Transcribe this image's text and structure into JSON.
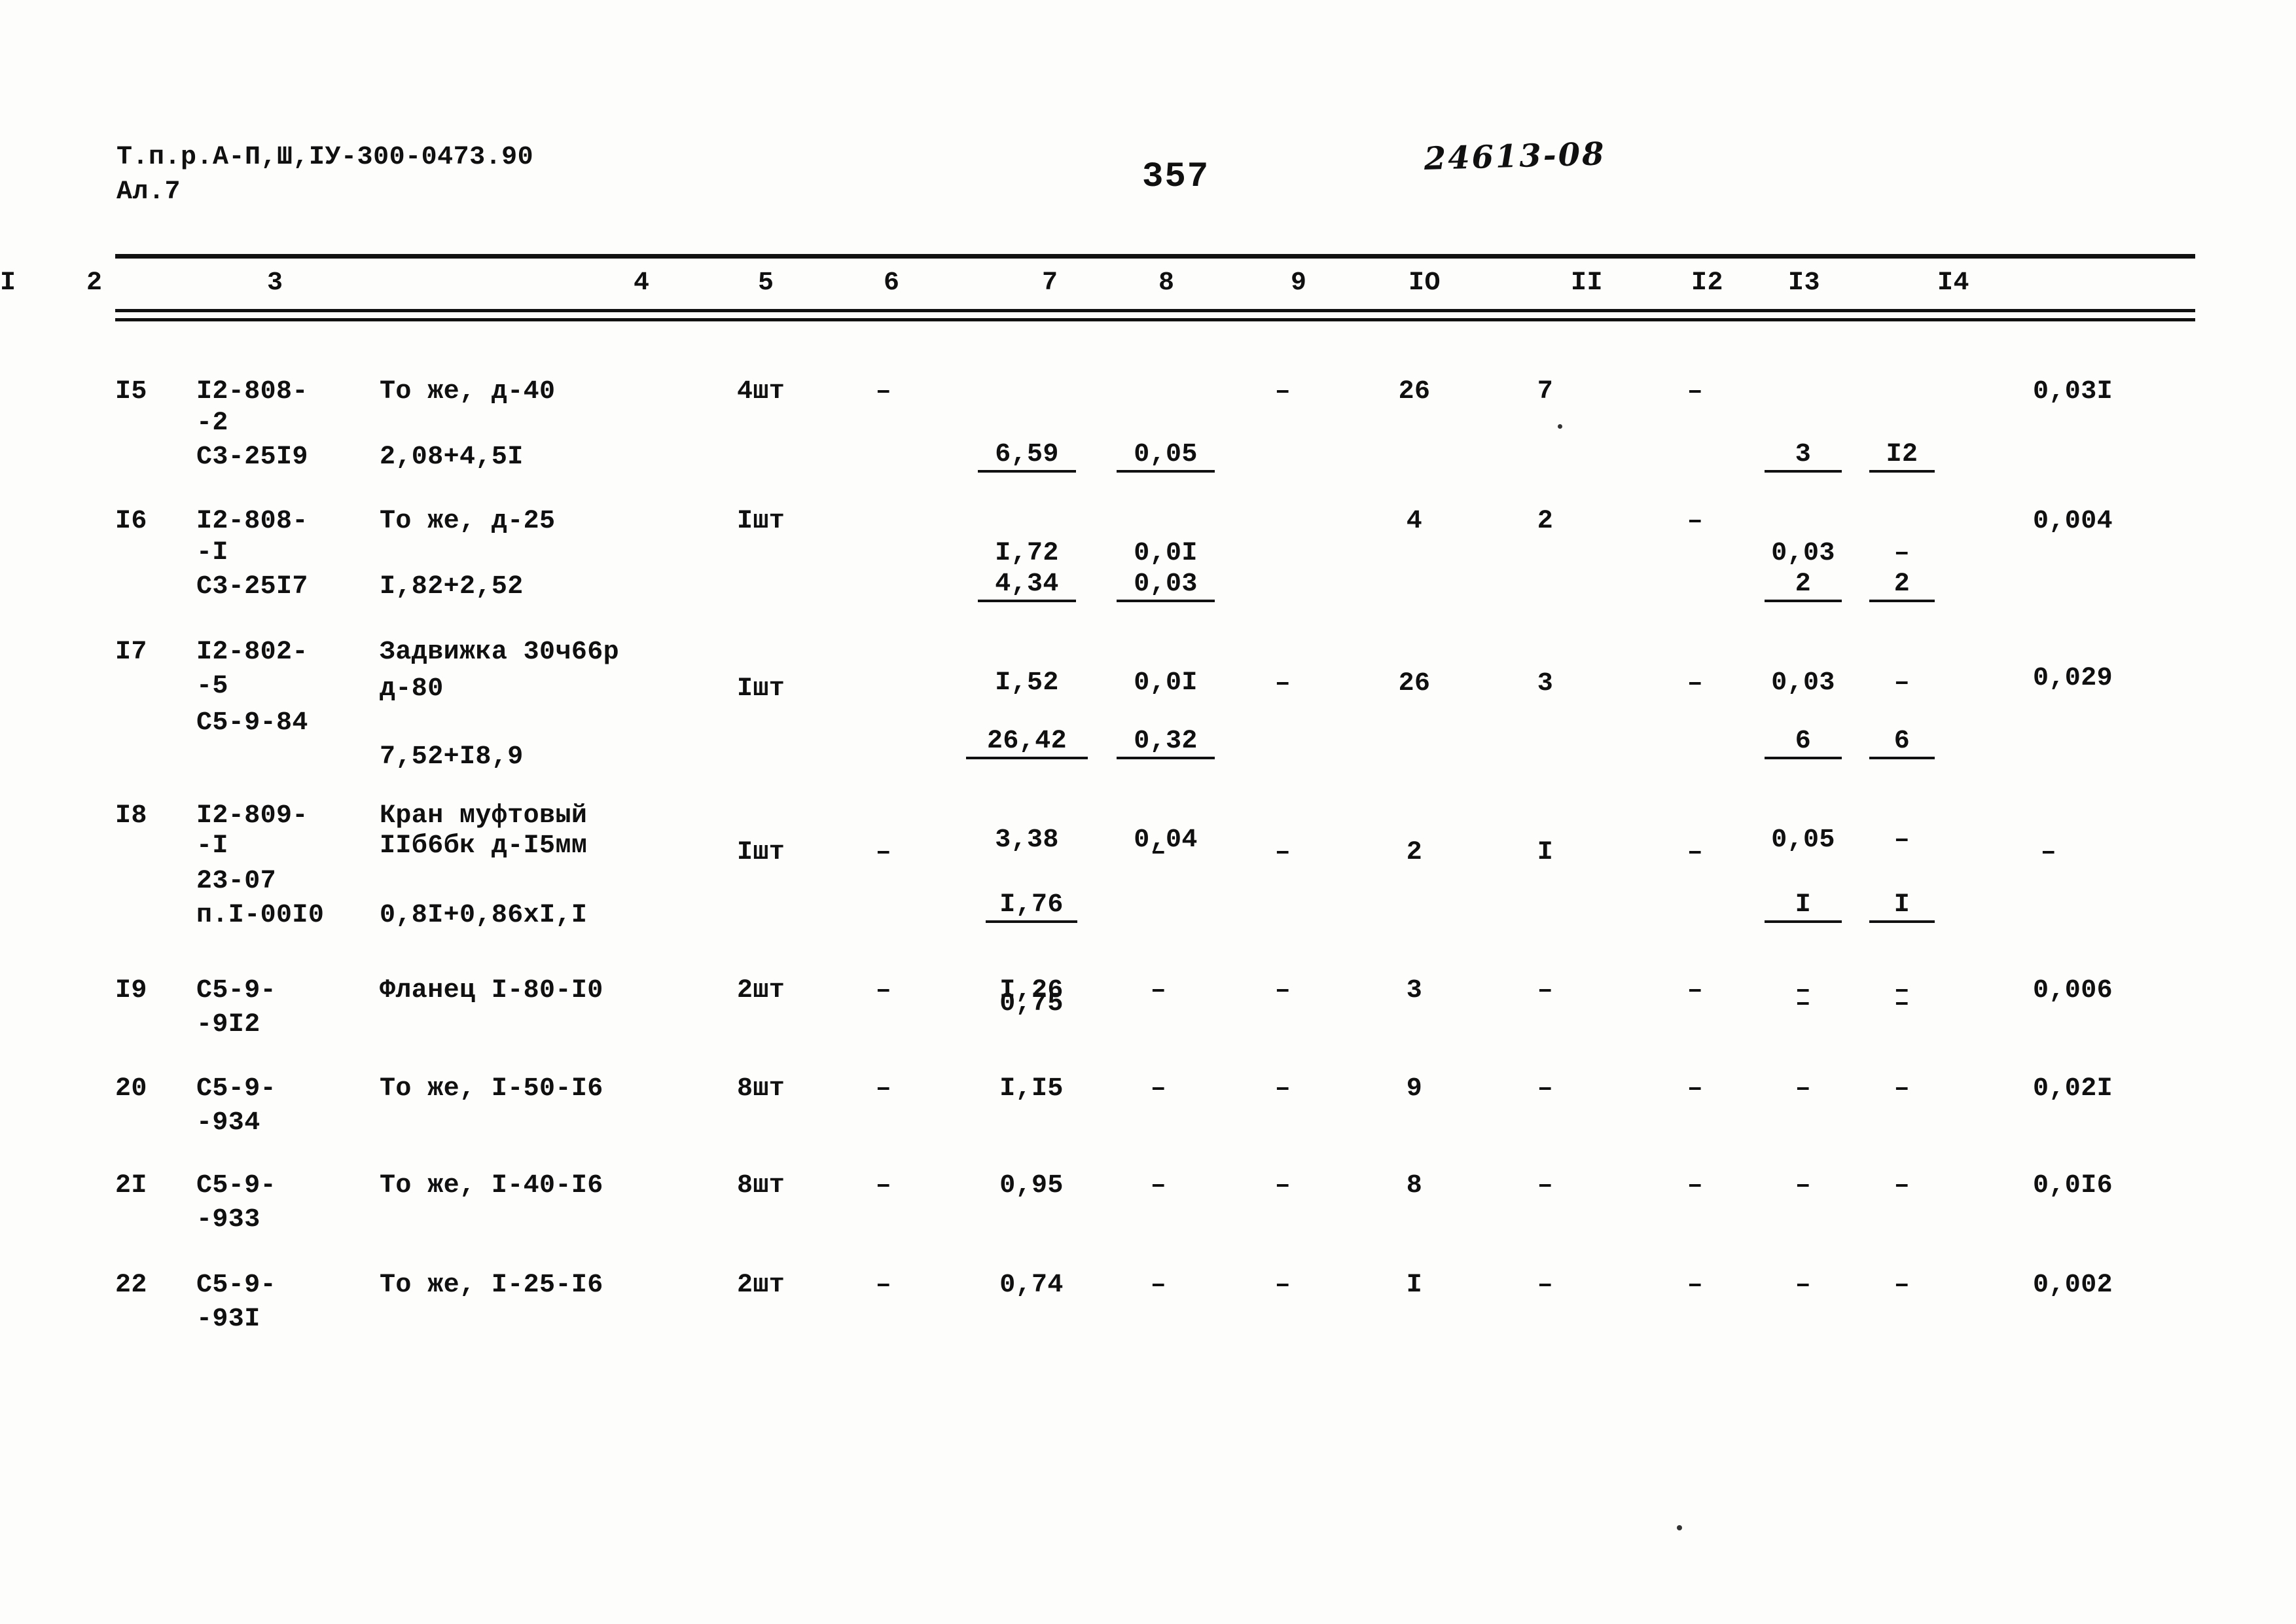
{
  "header": {
    "doc_code_line1": "Т.п.р.А-П,Ш,IУ-300-0473.90",
    "doc_code_line2": "Ал.7",
    "page_number": "357",
    "handwritten_code": "24613-08"
  },
  "table": {
    "column_headers": [
      "I",
      "2",
      "3",
      "4",
      "5",
      "6",
      "7",
      "8",
      "9",
      "IO",
      "II",
      "I2",
      "I3",
      "I4"
    ],
    "rows": [
      {
        "c1": "I5",
        "c2_line1": "I2-808-",
        "c2_line2": "-2",
        "c2_line3": "С3-25I9",
        "c3_line1": "То же, д-40",
        "c3_line2": "2,08+4,5I",
        "c4": "4шт",
        "c5": "–",
        "c6_num": "6,59",
        "c6_den": "I,72",
        "c7_num": "0,05",
        "c7_den": "0,0I",
        "c8": "–",
        "c9": "26",
        "c10": "7",
        "c11": "–",
        "c12_num": "3",
        "c12_den": "0,03",
        "c13_num": "I2",
        "c13_den": "–",
        "c14": "0,03I"
      },
      {
        "c1": "I6",
        "c2_line1": "I2-808-",
        "c2_line2": "-I",
        "c2_line3": "С3-25I7",
        "c3_line1": "То же, д-25",
        "c3_line2": "I,82+2,52",
        "c4": "Iшт",
        "c5": "",
        "c6_num": "4,34",
        "c6_den": "I,52",
        "c7_num": "0,03",
        "c7_den": "0,0I",
        "c8": "",
        "c9": "4",
        "c10": "2",
        "c11": "–",
        "c12_num": "2",
        "c12_den": "0,03",
        "c13_num": "2",
        "c13_den": "–",
        "c14": "0,004"
      },
      {
        "c1": "I7",
        "c2_line1": "I2-802-",
        "c2_line2": "-5",
        "c2_line3": "С5-9-84",
        "c3_line1": "Задвижка 30ч66р",
        "c3_line2": "д-80",
        "c3_line3": "7,52+I8,9",
        "c4": "Iшт",
        "c5": "",
        "c6_num": "26,42",
        "c6_den": "3,38",
        "c7_num": "0,32",
        "c7_den": "0,04",
        "c8": "–",
        "c9": "26",
        "c10": "3",
        "c11": "–",
        "c12_num": "6",
        "c12_den": "0,05",
        "c13_num": "6",
        "c13_den": "–",
        "c14": "0,029"
      },
      {
        "c1": "I8",
        "c2_line1": "I2-809-",
        "c2_line2": "-I",
        "c2_line3": "23-07",
        "c2_line4": "п.I-00I0",
        "c3_line1": "Кран муфтовый",
        "c3_line2": "IIб6бк д-I5мм",
        "c3_line3": "0,8I+0,86хI,I",
        "c4": "Iшт",
        "c5": "–",
        "c6_num": "I,76",
        "c6_den": "0,75",
        "c7_num": "–",
        "c7_den": "",
        "c8": "–",
        "c9": "2",
        "c10": "I",
        "c11": "–",
        "c12_num": "I",
        "c12_den": "–",
        "c13_num": "I",
        "c13_den": "–",
        "c14": "–"
      },
      {
        "c1": "I9",
        "c2_line1": "С5-9-",
        "c2_line2": "-9I2",
        "c3_line1": "Фланец I-80-I0",
        "c4": "2шт",
        "c5": "–",
        "c6_num": "I,26",
        "c6_den": "",
        "c7_num": "–",
        "c7_den": "",
        "c8": "–",
        "c9": "3",
        "c10": "–",
        "c11": "–",
        "c12_num": "–",
        "c12_den": "",
        "c13_num": "–",
        "c13_den": "",
        "c14": "0,006"
      },
      {
        "c1": "20",
        "c2_line1": "С5-9-",
        "c2_line2": "-934",
        "c3_line1": "То же, I-50-I6",
        "c4": "8шт",
        "c5": "–",
        "c6_num": "I,I5",
        "c6_den": "",
        "c7_num": "–",
        "c7_den": "",
        "c8": "–",
        "c9": "9",
        "c10": "–",
        "c11": "–",
        "c12_num": "–",
        "c12_den": "",
        "c13_num": "–",
        "c13_den": "",
        "c14": "0,02I"
      },
      {
        "c1": "2I",
        "c2_line1": "С5-9-",
        "c2_line2": "-933",
        "c3_line1": "То же, I-40-I6",
        "c4": "8шт",
        "c5": "–",
        "c6_num": "0,95",
        "c6_den": "",
        "c7_num": "–",
        "c7_den": "",
        "c8": "–",
        "c9": "8",
        "c10": "–",
        "c11": "–",
        "c12_num": "–",
        "c12_den": "",
        "c13_num": "–",
        "c13_den": "",
        "c14": "0,0I6"
      },
      {
        "c1": "22",
        "c2_line1": "С5-9-",
        "c2_line2": "-93I",
        "c3_line1": "То же, I-25-I6",
        "c4": "2шт",
        "c5": "–",
        "c6_num": "0,74",
        "c6_den": "",
        "c7_num": "–",
        "c7_den": "",
        "c8": "–",
        "c9": "I",
        "c10": "–",
        "c11": "–",
        "c12_num": "–",
        "c12_den": "",
        "c13_num": "–",
        "c13_den": "",
        "c14": "0,002"
      }
    ]
  }
}
